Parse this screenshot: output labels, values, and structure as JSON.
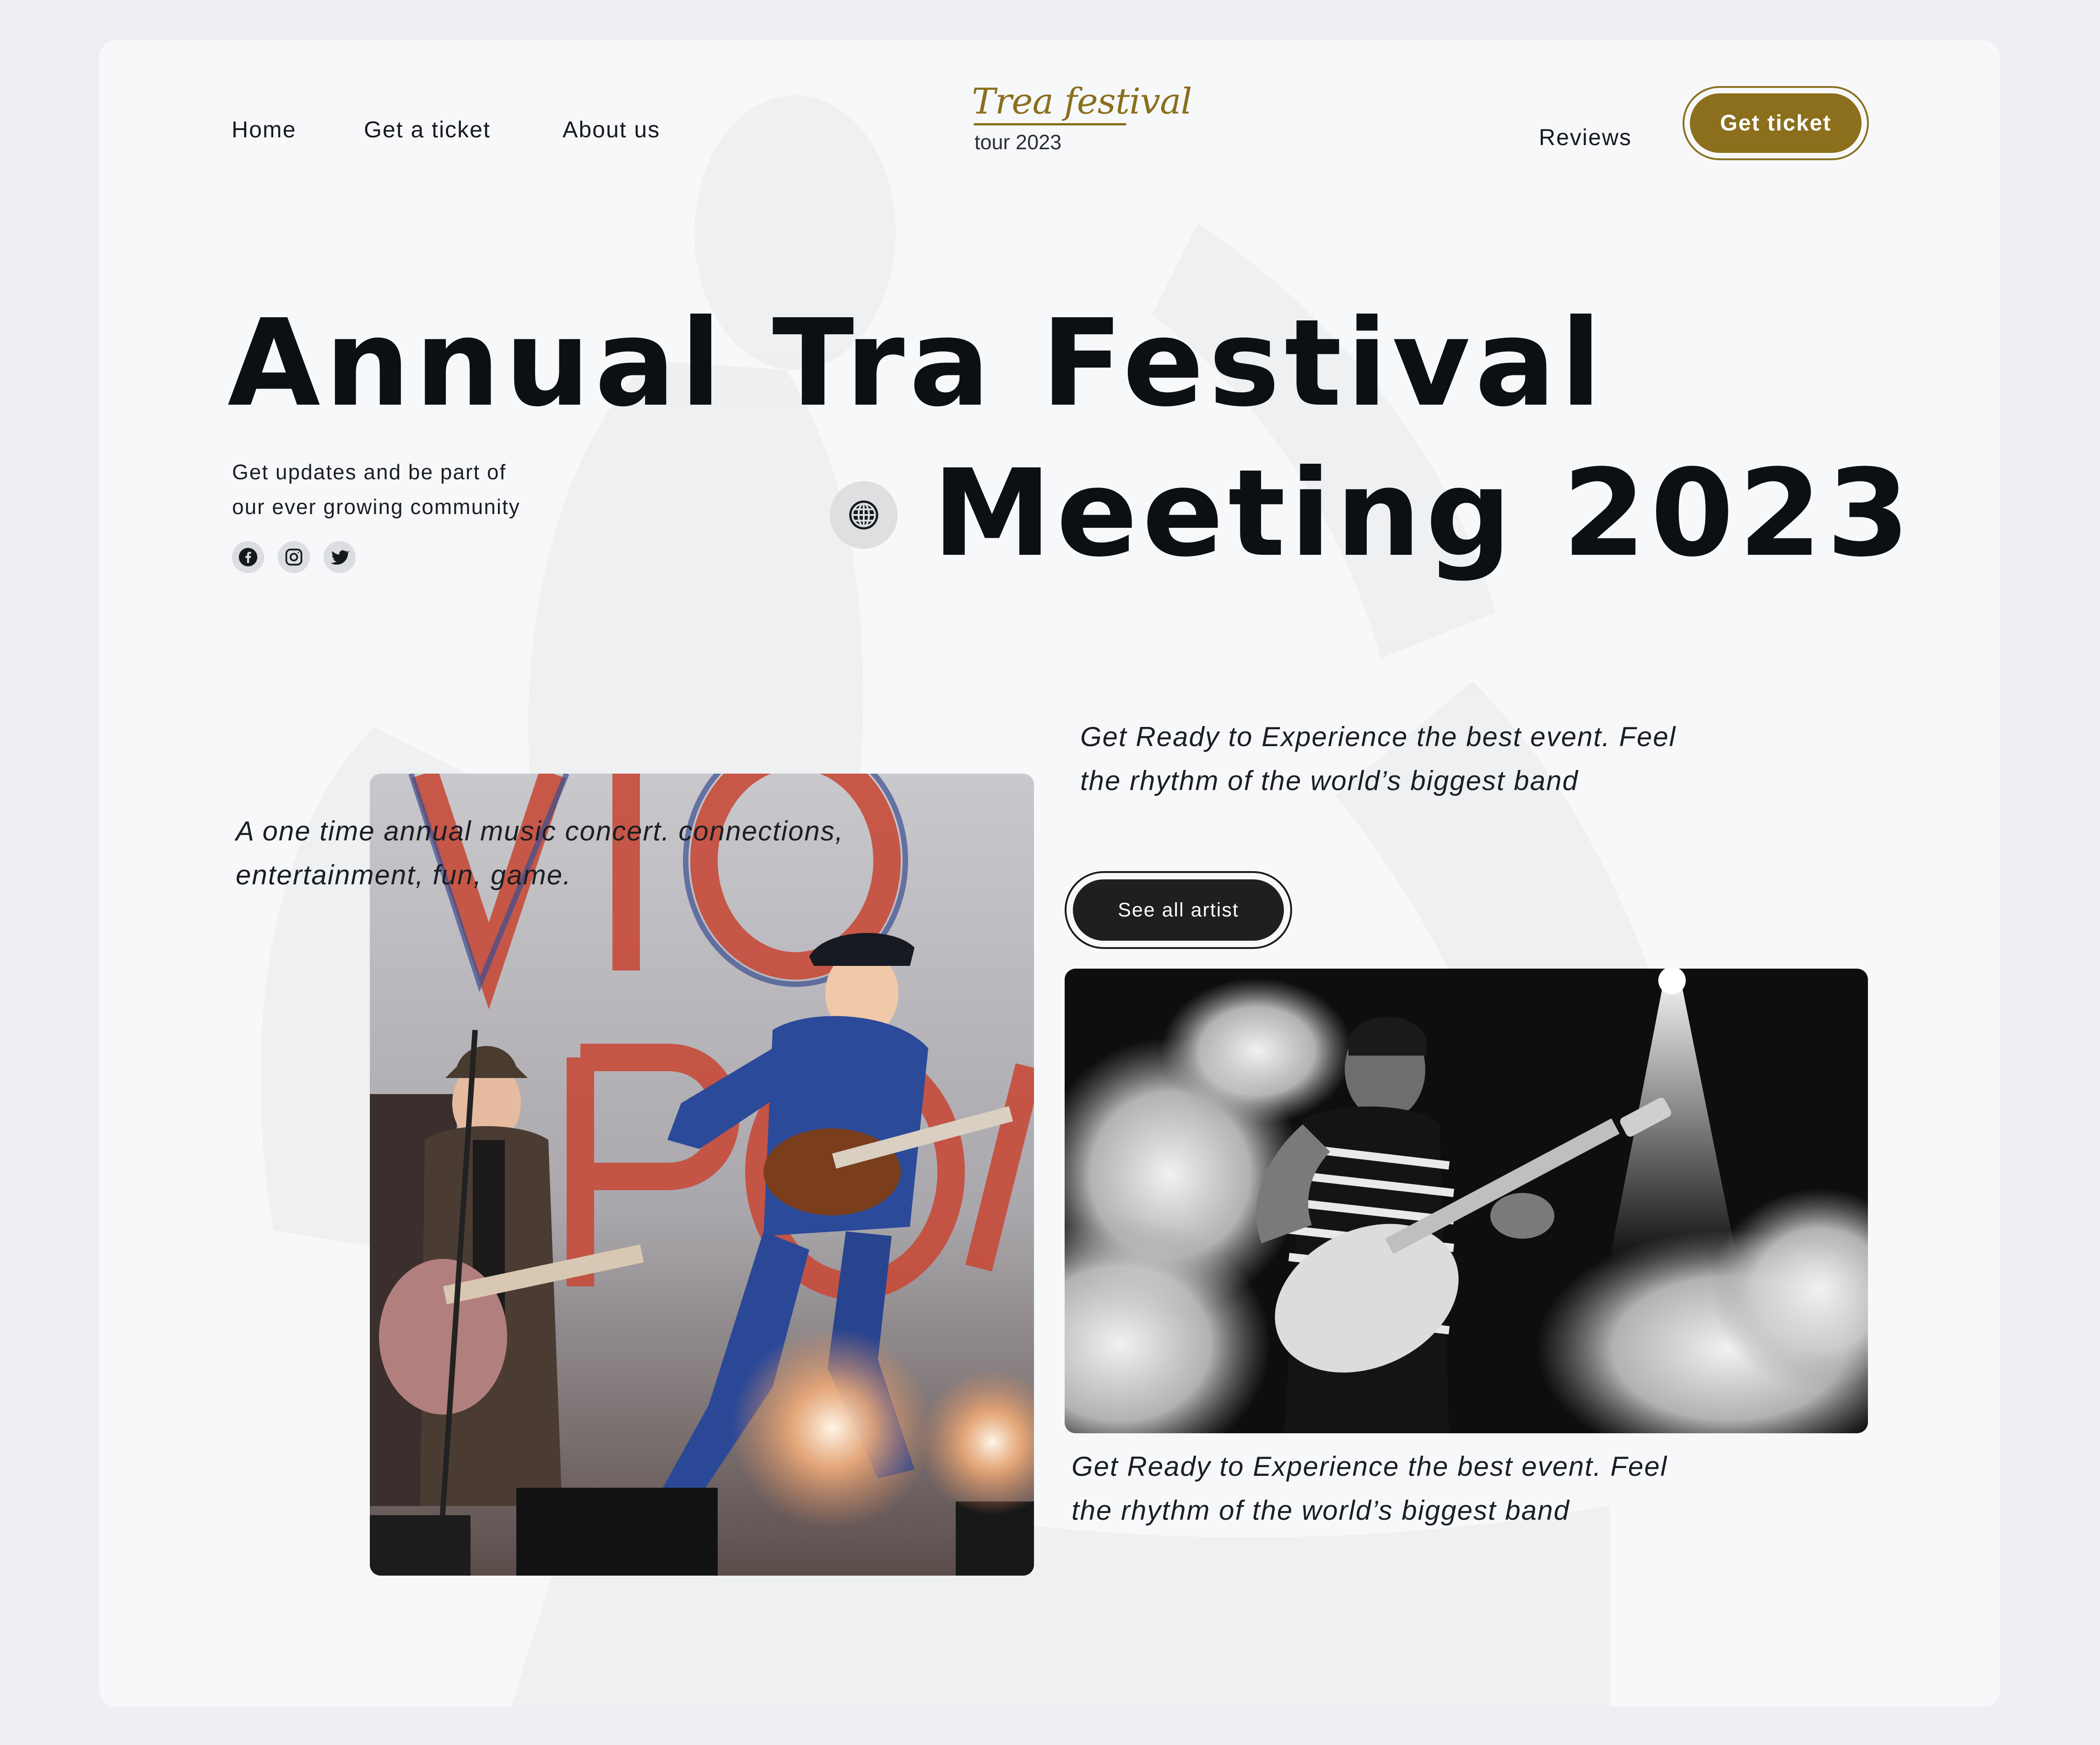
{
  "nav": {
    "links": [
      {
        "label": "Home"
      },
      {
        "label": "Get a ticket"
      },
      {
        "label": "About us"
      }
    ],
    "right_link": "Reviews",
    "cta_label": "Get ticket"
  },
  "logo": {
    "script_text": "Trea festival",
    "subtitle": "tour 2023"
  },
  "hero": {
    "title_line1": "Annual Tra Festival",
    "title_line2": "Meeting 2023",
    "tagline_line1": "Get updates and be part of",
    "tagline_line2": "our ever growing community",
    "social_icons": [
      "facebook-icon",
      "instagram-icon",
      "twitter-icon"
    ],
    "globe_icon": "globe-icon"
  },
  "content": {
    "left_text_line1": "A one time annual music concert. connections,",
    "left_text_line2": "entertainment, fun, game.",
    "top_text_line1": "Get Ready to Experience the best event. Feel",
    "top_text_line2": "the rhythm of the world’s biggest band",
    "see_all_label": "See all artist",
    "bottom_text_line1": "Get Ready to Experience the best event. Feel",
    "bottom_text_line2": "the rhythm of the world’s biggest band"
  },
  "colors": {
    "accent_gold": "#8b6f1c",
    "dark": "#0c1014",
    "card_bg": "#f7f8f9",
    "page_bg": "#efeff3"
  }
}
